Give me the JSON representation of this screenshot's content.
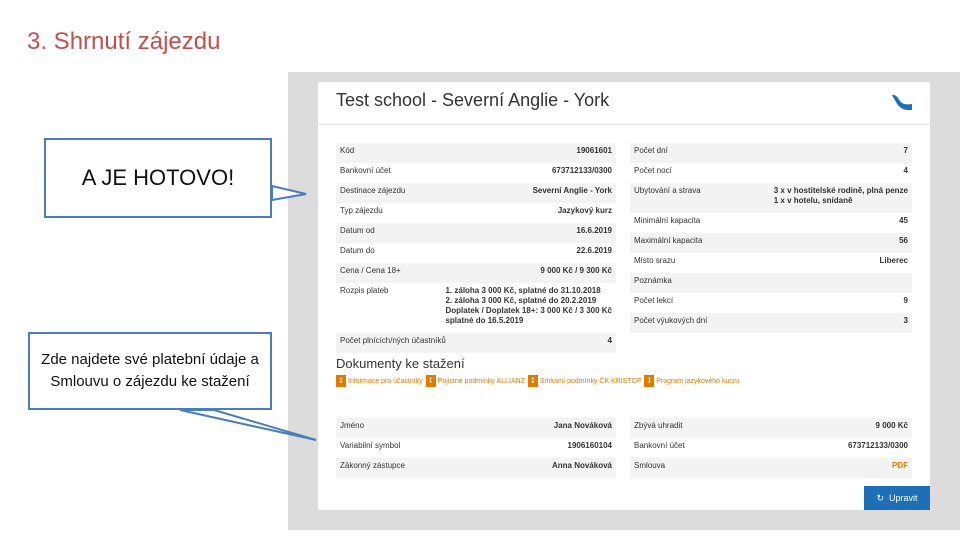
{
  "slide": {
    "title": "3. Shrnutí zájezdu",
    "callout_done": "A JE HOTOVO!",
    "callout_info": "Zde najdete své platební údaje a Smlouvu o zájezdu ke stažení"
  },
  "app": {
    "title": "Test school - Severní Anglie - York",
    "info_left": [
      {
        "label": "Kód",
        "value": "19061601"
      },
      {
        "label": "Bankovní účet",
        "value": "673712133/0300"
      },
      {
        "label": "Destinace zájezdu",
        "value": "Severní Anglie - York"
      },
      {
        "label": "Typ zájezdu",
        "value": "Jazykový kurz"
      },
      {
        "label": "Datum od",
        "value": "16.6.2019"
      },
      {
        "label": "Datum do",
        "value": "22.6.2019"
      },
      {
        "label": "Cena / Cena 18+",
        "value": "9 000 Kč / 9 300 Kč"
      },
      {
        "label": "Rozpis plateb",
        "value": "1. záloha 3 000 Kč, splatné do 31.10.2018\n2. záloha 3 000 Kč, splatné do 20.2.2019\nDoplatek / Doplatek 18+: 3 000 Kč / 3 300 Kč\nsplatné do 16.5.2019"
      },
      {
        "label": "Počet plnících/ných účastníků",
        "value": "4"
      }
    ],
    "info_right": [
      {
        "label": "Počet dní",
        "value": "7"
      },
      {
        "label": "Počet nocí",
        "value": "4"
      },
      {
        "label": "Ubytování a strava",
        "value": "3 x v hostitelské rodině, plná penze\n1 x v hotelu, snídaně"
      },
      {
        "label": "Minimální kapacita",
        "value": "45"
      },
      {
        "label": "Maximální kapacita",
        "value": "56"
      },
      {
        "label": "Místo srazu",
        "value": "Liberec"
      },
      {
        "label": "Poznámka",
        "value": ""
      },
      {
        "label": "Počet lekcí",
        "value": "9"
      },
      {
        "label": "Počet výukových dní",
        "value": "3"
      }
    ],
    "docs_heading": "Dokumenty ke stažení",
    "docs": [
      "Informace pro účastníky",
      "Pojistné podmínky ALLIANZ",
      "Smluvní podmínky CK KRISTOF",
      "Program jazykového kurzu"
    ],
    "pay_left": [
      {
        "label": "Jméno",
        "value": "Jana Nováková"
      },
      {
        "label": "Variabilní symbol",
        "value": "1906160104"
      },
      {
        "label": "Zákonný zástupce",
        "value": "Anna Nováková"
      }
    ],
    "pay_right": [
      {
        "label": "Zbývá uhradit",
        "value": "9 000 Kč"
      },
      {
        "label": "Bankovní účet",
        "value": "673712133/0300"
      },
      {
        "label": "Smlouva",
        "value": "PDF"
      }
    ],
    "edit_label": "Upravit"
  }
}
